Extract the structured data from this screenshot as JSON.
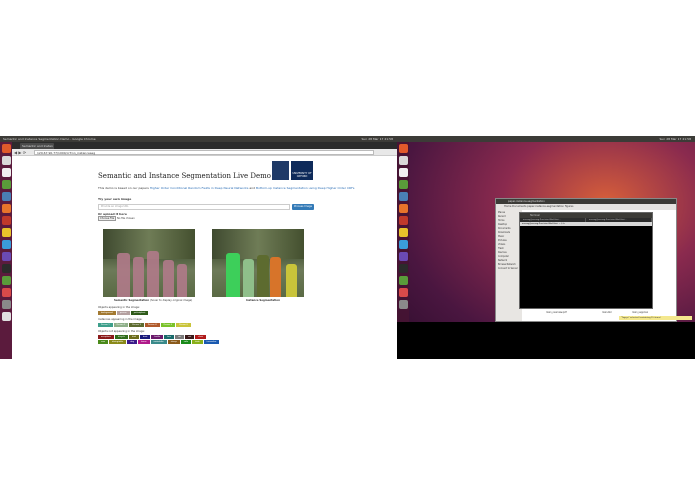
{
  "left_screen": {
    "topbar_title": "Semantic and Instance Segmentation Demo - Google Chrome",
    "clock": "Sun 28 Mar 17 21:58",
    "tab_title": "Semantic and Instan",
    "url": "129.67.90.77/1000/crfrnn_instanceseg",
    "page_title": "Semantic and Instance Segmentation Live Demo",
    "intro_text": "This demo is based on our papers",
    "intro_link1": "Higher Order Conditional Random Fields in Deep Neural Networks",
    "intro_and": "and",
    "intro_link2": "Bottom-up Instance Segmentation using Deep Higher Order CRFs",
    "try_own_label": "Try your own image",
    "url_placeholder": "Provide an image URL",
    "process_button": "Process Image",
    "upload_label": "Or upload it here",
    "choose_file_button": "Choose File",
    "no_file_text": "No file chosen",
    "logo_text": "UNIVERSITY OF OXFORD",
    "caption1_bold": "Semantic Segmentation",
    "caption1_rest": "(hover to display original image)",
    "caption2": "Instance Segmentation",
    "objects_label": "Objects appearing in the image:",
    "objects_tags": [
      {
        "label": "background",
        "color": "#a37a32"
      },
      {
        "label": "person",
        "color": "#b4a0a0"
      },
      {
        "label": "pottedplant",
        "color": "#2f5b1a"
      }
    ],
    "instances_label": "Instances appearing in the image:",
    "instances_tags": [
      {
        "label": "Person 1",
        "color": "#3d9f8b"
      },
      {
        "label": "Person 2",
        "color": "#8fb08a"
      },
      {
        "label": "Person 3",
        "color": "#5d6b2f"
      },
      {
        "label": "Person 4",
        "color": "#b05a2a"
      },
      {
        "label": "Person 5",
        "color": "#7ac22a"
      },
      {
        "label": "Person 6",
        "color": "#c9c43a"
      }
    ],
    "not_appearing_label": "Objects not appearing in the image:",
    "not_appearing_tags": [
      {
        "label": "aeroplane",
        "color": "#8a1a1a"
      },
      {
        "label": "bicycle",
        "color": "#2f6b1a"
      },
      {
        "label": "bird",
        "color": "#6b6b1a"
      },
      {
        "label": "boat",
        "color": "#1a1a7a"
      },
      {
        "label": "bottle",
        "color": "#6b1a6b"
      },
      {
        "label": "bus",
        "color": "#1a6b6b"
      },
      {
        "label": "car",
        "color": "#7a7a7a"
      },
      {
        "label": "cat",
        "color": "#3a1a1a"
      },
      {
        "label": "chair",
        "color": "#b01a1a"
      },
      {
        "label": "cow",
        "color": "#4a8a1a"
      },
      {
        "label": "diningtable",
        "color": "#8a8a1a"
      },
      {
        "label": "dog",
        "color": "#3a1a8a"
      },
      {
        "label": "horse",
        "color": "#b01a8a"
      },
      {
        "label": "motorbike",
        "color": "#3a8a8a"
      },
      {
        "label": "sheep",
        "color": "#8a5a1a"
      },
      {
        "label": "sofa",
        "color": "#1a8a1a"
      },
      {
        "label": "train",
        "color": "#8ab01a"
      },
      {
        "label": "tvmonitor",
        "color": "#1a5ab0"
      }
    ]
  },
  "right_screen": {
    "clock": "Sun 28 Mar 17 21:58",
    "files_title": "paper-instance-segmentation",
    "files_tool": "Home   Documents   paper-instance-segmentation   figures",
    "files_sidebar": [
      "Places",
      "Recent",
      "Home",
      "Desktop",
      "Documents",
      "Downloads",
      "Music",
      "Pictures",
      "Videos",
      "Trash",
      "Devices",
      "Computer",
      "Network",
      "Browse Network",
      "Connect to Server"
    ],
    "files": [
      "main_overview.pdf",
      "main.bbl",
      "main_supp.tex",
      "main_supp.bbl"
    ],
    "term_title": "Terminal",
    "term_tabs": [
      "anurag@anurag-Precision-WorkStat...",
      "anurag@anurag-Precision-WorkStat..."
    ],
    "term_line": "anurag@anurag-Precision-WorkStat: ~ $ ls",
    "notification": "\"Tagsys\" selected (containing 15 items)"
  }
}
